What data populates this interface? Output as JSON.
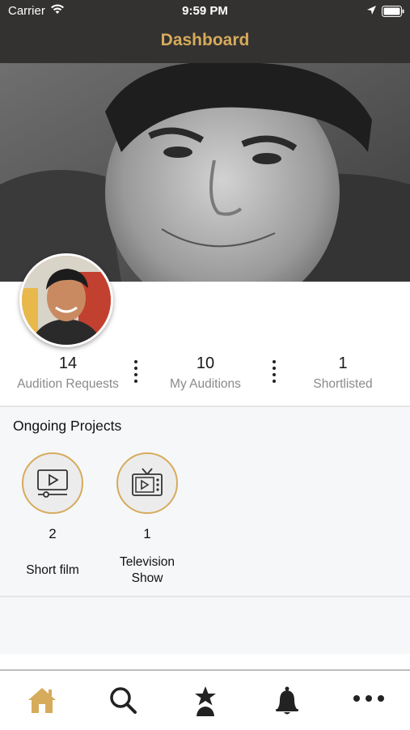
{
  "status_bar": {
    "carrier": "Carrier",
    "time": "9:59 PM"
  },
  "nav": {
    "title": "Dashboard"
  },
  "profile": {
    "cover_image": "profile-cover-photo",
    "avatar_image": "profile-avatar-photo"
  },
  "stats": [
    {
      "value": "14",
      "label": "Audition Requests"
    },
    {
      "value": "10",
      "label": "My Auditions"
    },
    {
      "value": "1",
      "label": "Shortlisted"
    }
  ],
  "ongoing": {
    "title": "Ongoing Projects",
    "items": [
      {
        "count": "2",
        "label": "Short film",
        "icon": "video-player-icon"
      },
      {
        "count": "1",
        "label": "Television Show",
        "icon": "television-icon"
      }
    ]
  },
  "tab_bar": {
    "items": [
      {
        "icon": "home-icon",
        "active": true
      },
      {
        "icon": "search-icon",
        "active": false
      },
      {
        "icon": "star-person-icon",
        "active": false
      },
      {
        "icon": "bell-icon",
        "active": false
      },
      {
        "icon": "more-icon",
        "active": false
      }
    ]
  },
  "colors": {
    "accent": "#d6ab5c",
    "nav_background": "#333230",
    "section_background": "#f6f7f9"
  }
}
